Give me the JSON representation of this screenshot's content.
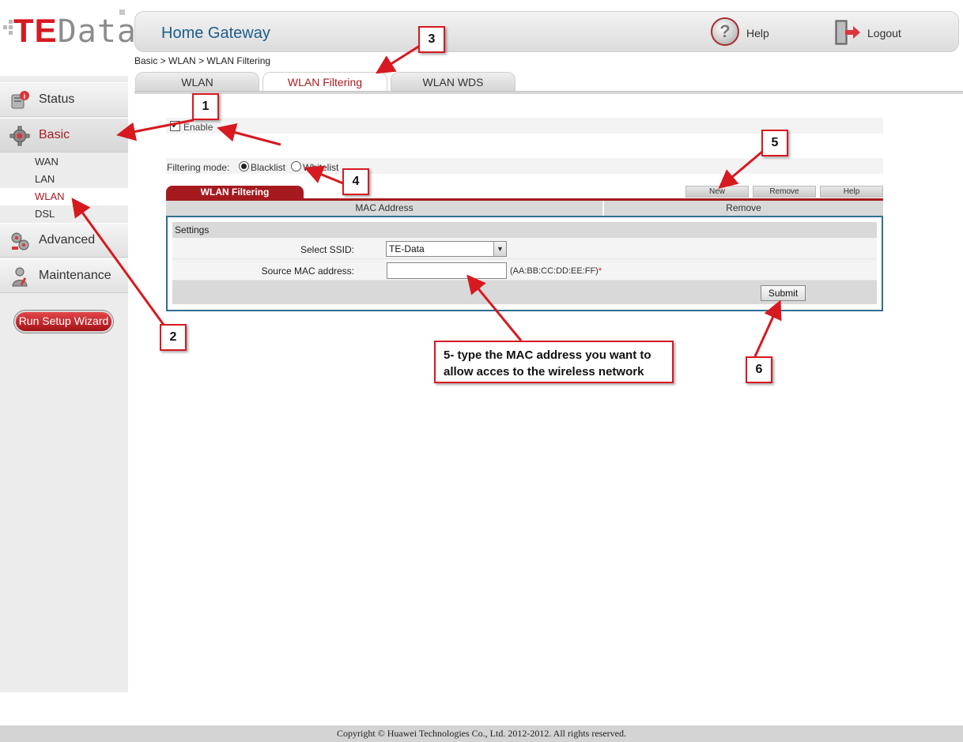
{
  "brand": {
    "logo_te": "TE",
    "logo_data": "Data"
  },
  "header": {
    "title": "Home Gateway",
    "help_label": "Help",
    "logout_label": "Logout"
  },
  "breadcrumb": "Basic > WLAN > WLAN Filtering",
  "sidebar": {
    "items": [
      {
        "label": "Status",
        "icon": "status-icon",
        "active": false
      },
      {
        "label": "Basic",
        "icon": "gear-icon",
        "active": true
      },
      {
        "label": "Advanced",
        "icon": "advanced-icon",
        "active": false
      },
      {
        "label": "Maintenance",
        "icon": "maintenance-icon",
        "active": false
      }
    ],
    "submenu": [
      {
        "label": "WAN",
        "active": false
      },
      {
        "label": "LAN",
        "active": false
      },
      {
        "label": "WLAN",
        "active": true
      },
      {
        "label": "DSL",
        "active": false
      }
    ],
    "wizard_label": "Run Setup Wizard"
  },
  "tabs": [
    {
      "label": "WLAN",
      "active": false
    },
    {
      "label": "WLAN Filtering",
      "active": true
    },
    {
      "label": "WLAN WDS",
      "active": false
    }
  ],
  "filter": {
    "enable_label": "Enable",
    "enabled": true,
    "mode_label": "Filtering mode:",
    "mode_options": [
      "Blacklist",
      "Whitelist"
    ],
    "mode_selected": "Blacklist"
  },
  "table": {
    "section_label": "WLAN Filtering",
    "buttons": [
      "New",
      "Remove",
      "Help"
    ],
    "columns": [
      "MAC Address",
      "Remove"
    ]
  },
  "settings": {
    "title": "Settings",
    "ssid_label": "Select SSID:",
    "ssid_value": "TE-Data",
    "mac_label": "Source MAC address:",
    "mac_value": "",
    "mac_hint": "(AA:BB:CC:DD:EE:FF)",
    "mac_required": "*",
    "submit_label": "Submit"
  },
  "annotations": {
    "callouts": [
      "1",
      "2",
      "3",
      "4",
      "5",
      "6"
    ],
    "note": "5- type the MAC address you want to allow acces to the wireless network"
  },
  "footer": "Copyright © Huawei Technologies Co., Ltd. 2012-2012. All rights reserved.",
  "colors": {
    "accent": "#a61d22",
    "brand_red": "#d71920",
    "header_title": "#1c5d8c",
    "settings_border": "#2f6f8f"
  }
}
